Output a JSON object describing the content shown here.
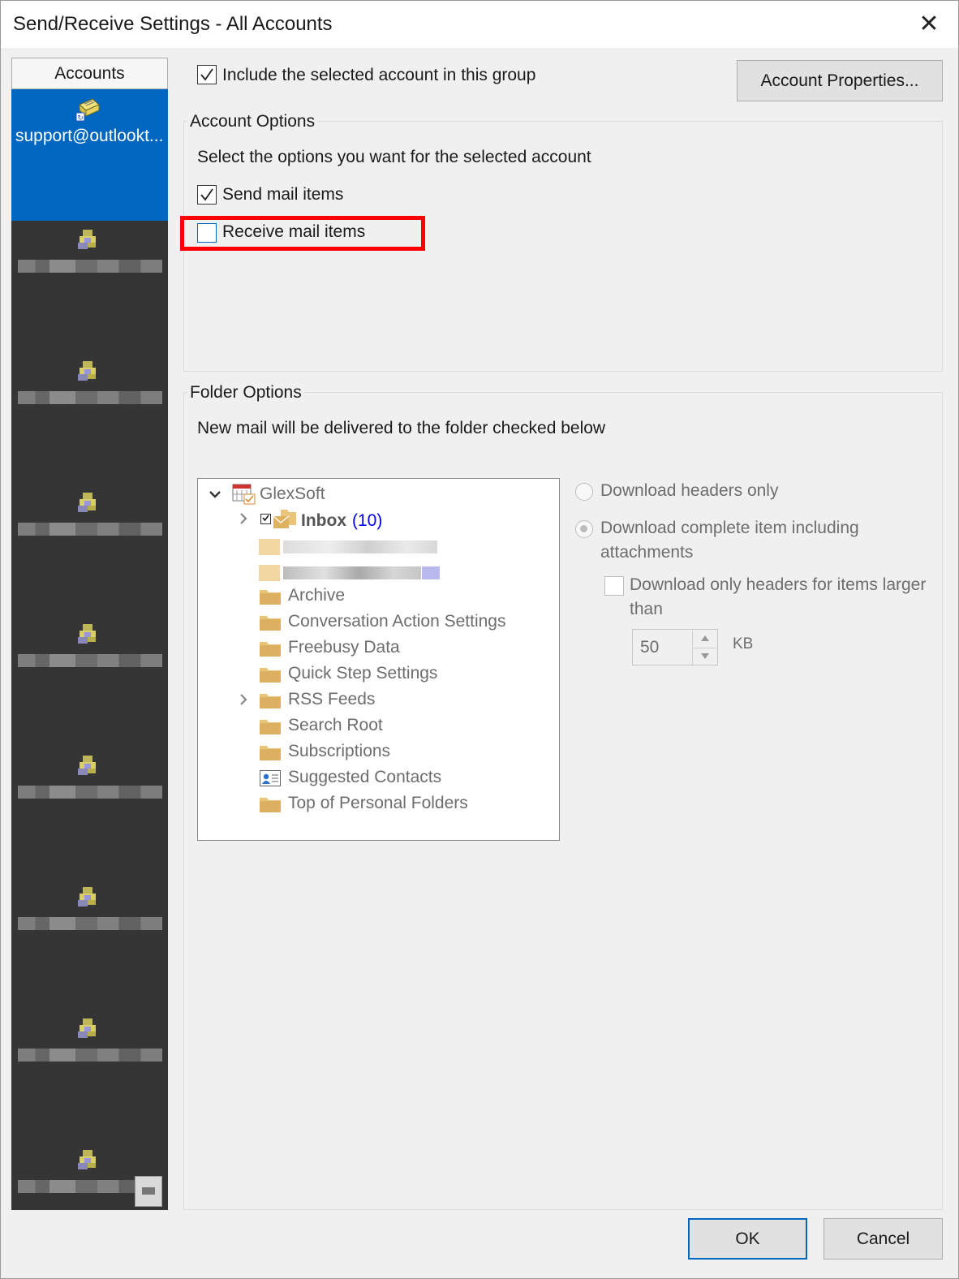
{
  "window": {
    "title": "Send/Receive Settings - All Accounts",
    "close_glyph": "✕"
  },
  "accounts": {
    "header": "Accounts",
    "selected_label": "support@outlookt...",
    "item_count": 9
  },
  "top": {
    "include_label": "Include the selected account in this group",
    "include_checked": true,
    "account_properties_label": "Account Properties..."
  },
  "account_options": {
    "legend": "Account Options",
    "description": "Select the options you want for the selected account",
    "send_label": "Send mail items",
    "send_checked": true,
    "receive_label": "Receive mail items",
    "receive_checked": false
  },
  "folder_options": {
    "legend": "Folder Options",
    "description": "New mail will be delivered to the folder checked below",
    "tree": {
      "root": "GlexSoft",
      "inbox_label": "Inbox",
      "inbox_count": "(10)",
      "folders": [
        "Archive",
        "Conversation Action Settings",
        "Freebusy Data",
        "Quick Step Settings",
        "RSS Feeds",
        "Search Root",
        "Subscriptions",
        "Suggested Contacts",
        "Top of Personal Folders"
      ]
    },
    "radio_headers": "Download headers only",
    "radio_complete_line1": "Download complete item including",
    "radio_complete_line2": "attachments",
    "larger_line1": "Download only headers for items larger",
    "larger_line2": "than",
    "size_value": "50",
    "size_unit": "KB"
  },
  "footer": {
    "ok_label": "OK",
    "cancel_label": "Cancel"
  },
  "colors": {
    "selection": "#0067c0",
    "highlight_box": "#ff0000",
    "inbox_count": "#0000ee"
  }
}
